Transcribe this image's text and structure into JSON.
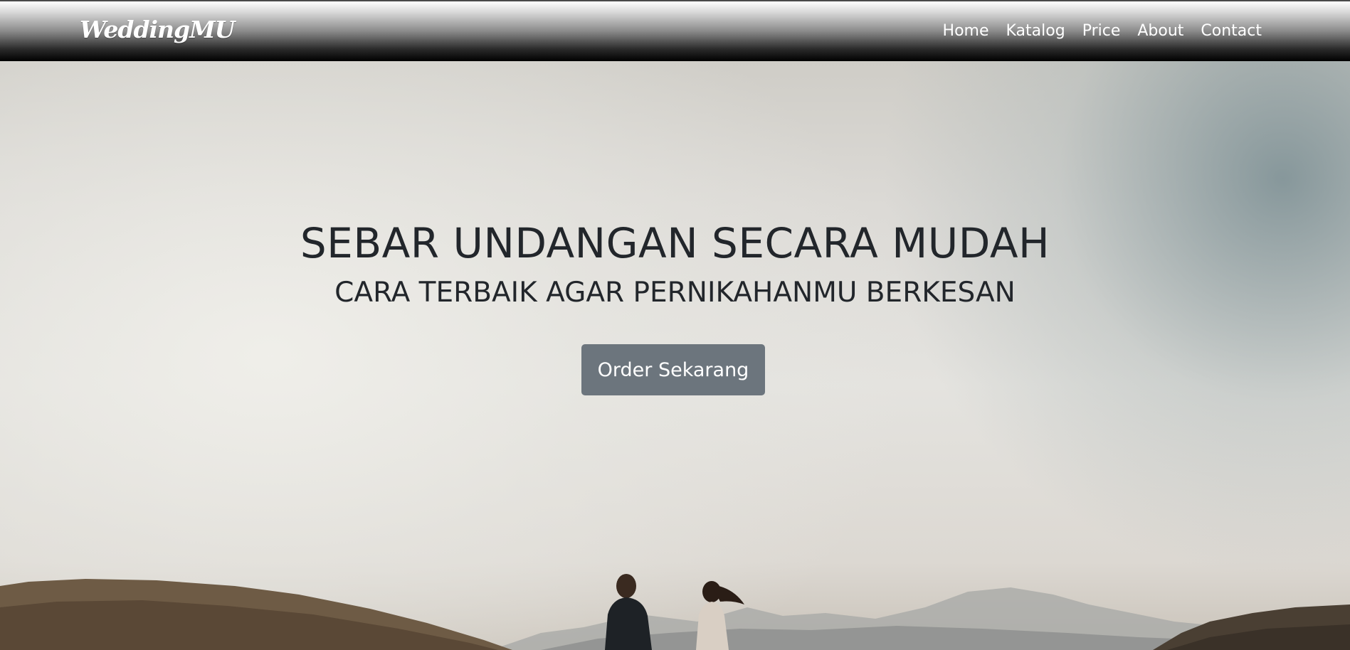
{
  "navbar": {
    "brand": "WeddingMU",
    "links": [
      {
        "label": "Home"
      },
      {
        "label": "Katalog"
      },
      {
        "label": "Price"
      },
      {
        "label": "About"
      },
      {
        "label": "Contact"
      }
    ]
  },
  "hero": {
    "title": "SEBAR UNDANGAN SECARA MUDAH",
    "subtitle": "CARA TERBAIK AGAR PERNIKAHANMU BERKESAN",
    "cta_label": "Order Sekarang"
  },
  "colors": {
    "button_bg": "#6c757d",
    "heading_text": "#22262b",
    "nav_text": "#ffffff"
  }
}
